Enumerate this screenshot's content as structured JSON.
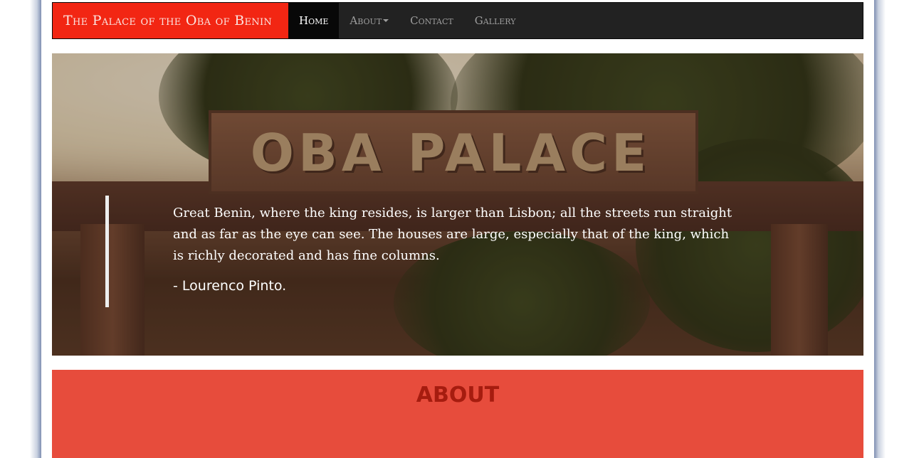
{
  "navbar": {
    "brand": "The Palace of the Oba of Benin",
    "items": [
      {
        "label": "Home",
        "active": true,
        "dropdown": false
      },
      {
        "label": "About",
        "active": false,
        "dropdown": true
      },
      {
        "label": "Contact",
        "active": false,
        "dropdown": false
      },
      {
        "label": "Gallery",
        "active": false,
        "dropdown": false
      }
    ]
  },
  "hero": {
    "sign_text": "OBA PALACE",
    "quote": "Great Benin, where the king resides, is larger than Lisbon; all the streets run straight and as far as the eye can see. The houses are large, especially that of the king, which is richly decorated and has fine columns.",
    "author": "- Lourenco Pinto."
  },
  "about": {
    "title": "ABOUT"
  },
  "colors": {
    "brand_bg": "#f22613",
    "navbar_bg": "#222222",
    "about_bg": "#e74c3c",
    "about_title": "#a61c0f"
  }
}
